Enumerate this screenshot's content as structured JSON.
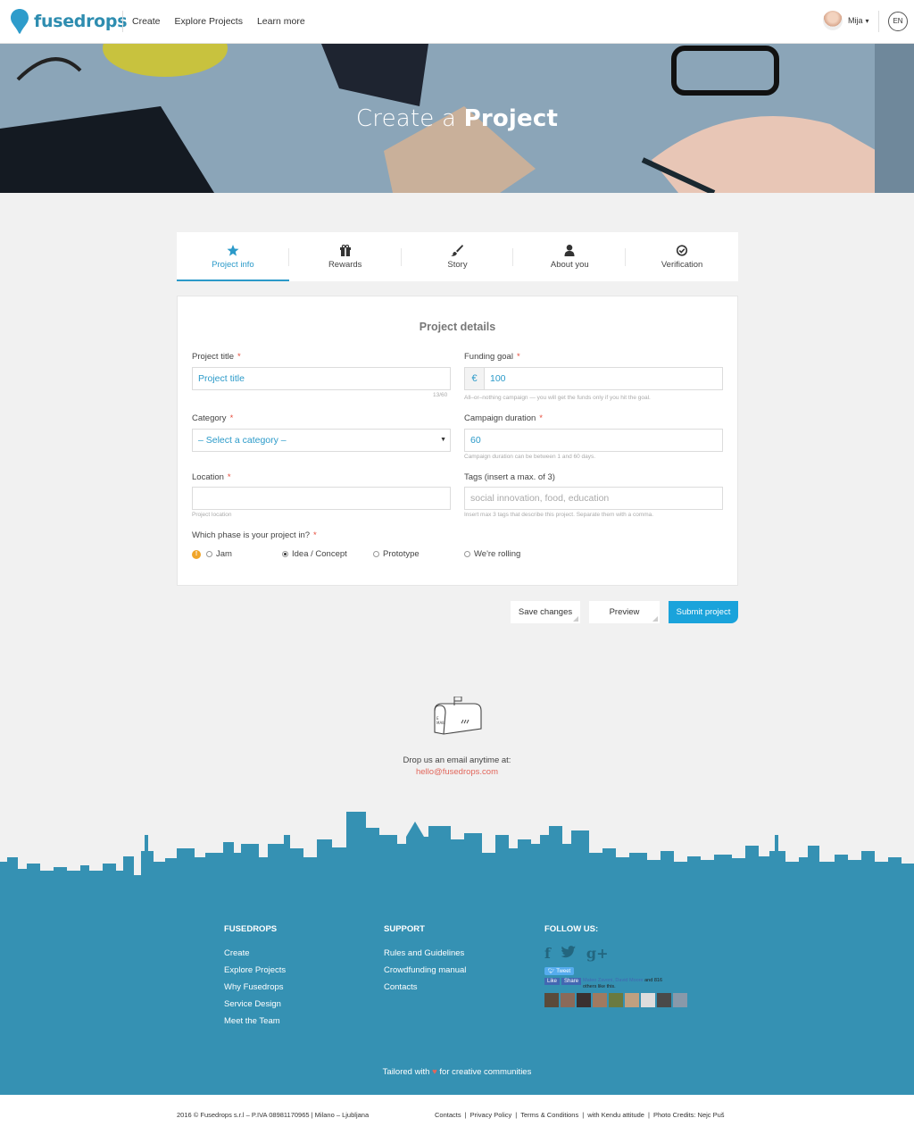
{
  "header": {
    "logo": "fusedrops",
    "nav": [
      "Create",
      "Explore Projects",
      "Learn more"
    ],
    "user_name": "Mija",
    "language": "EN"
  },
  "hero": {
    "title_light": "Create a",
    "title_bold": "Project"
  },
  "tabs": [
    {
      "label": "Project info",
      "icon": "star-icon",
      "active": true
    },
    {
      "label": "Rewards",
      "icon": "gift-icon",
      "active": false
    },
    {
      "label": "Story",
      "icon": "brush-icon",
      "active": false
    },
    {
      "label": "About you",
      "icon": "user-icon",
      "active": false
    },
    {
      "label": "Verification",
      "icon": "check-circle-icon",
      "active": false
    }
  ],
  "form": {
    "title": "Project details",
    "project_title": {
      "label": "Project title",
      "value": "Project title",
      "counter": "13/60"
    },
    "funding_goal": {
      "label": "Funding goal",
      "currency": "€",
      "value": "100",
      "help": "All–or–nothing campaign — you will get the funds only if you hit the goal."
    },
    "category": {
      "label": "Category",
      "value": "– Select a category –"
    },
    "campaign_duration": {
      "label": "Campaign duration",
      "value": "60",
      "help": "Campaign duration can be between 1 and 60 days."
    },
    "location": {
      "label": "Location",
      "value": "",
      "help": "Project location"
    },
    "tags": {
      "label": "Tags (insert a max. of 3)",
      "placeholder": "social innovation, food, education",
      "help": "Insert max 3 tags that describe this project. Separate them with a comma."
    },
    "phase": {
      "label": "Which phase is your project in?",
      "info": "!",
      "options": [
        "Jam",
        "Idea / Concept",
        "Prototype",
        "We're rolling"
      ],
      "selected": "Idea / Concept"
    }
  },
  "buttons": {
    "save": "Save changes",
    "preview": "Preview",
    "submit": "Submit project"
  },
  "contact": {
    "text": "Drop us an email anytime at:",
    "email": "hello@fusedrops.com"
  },
  "footer": {
    "fusedrops": {
      "heading": "FUSEDROPS",
      "links": [
        "Create",
        "Explore Projects",
        "Why Fusedrops",
        "Service Design",
        "Meet the Team"
      ]
    },
    "support": {
      "heading": "SUPPORT",
      "links": [
        "Rules and Guidelines",
        "Crowdfunding manual",
        "Contacts"
      ]
    },
    "follow": {
      "heading": "FOLLOW US:",
      "icons": [
        "facebook-icon",
        "twitter-icon",
        "google-plus-icon"
      ],
      "tweet": "Tweet",
      "fb_like": "Like",
      "fb_share": "Share",
      "fb_names": "Mateo Zavoni, David Moore",
      "fb_text": "and 816 others like this."
    },
    "tailored_before": "Tailored with",
    "tailored_after": "for creative communities",
    "copyright": "2016 © Fusedrops s.r.l – P.IVA 08981170965  |  Milano – Ljubljana",
    "bottom_links": [
      "Contacts",
      "Privacy Policy",
      "Terms & Conditions",
      "with Kendu attitude",
      "Photo Credits: Nejc Puš"
    ]
  },
  "colors": {
    "accent": "#2b9ac9",
    "primary_button": "#1aa3db",
    "footer": "#3591b3",
    "required": "#e74c3c",
    "email": "#e2665b"
  }
}
